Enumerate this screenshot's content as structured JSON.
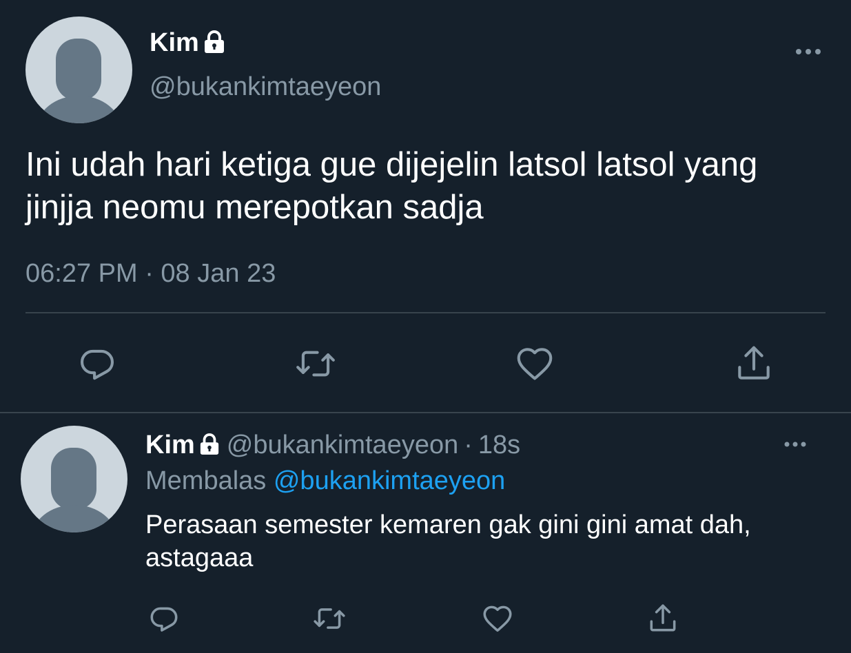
{
  "main_tweet": {
    "display_name": "Kim",
    "handle": "@bukankimtaeyeon",
    "text": "Ini udah hari ketiga gue dijejelin latsol latsol yang jinjja neomu merepotkan sadja",
    "timestamp": "06:27 PM · 08 Jan 23",
    "protected_icon": "lock-icon",
    "actions": [
      "reply-icon",
      "retweet-icon",
      "like-icon",
      "share-icon"
    ]
  },
  "reply_tweet": {
    "display_name": "Kim",
    "handle": "@bukankimtaeyeon",
    "separator": "·",
    "age": "18s",
    "replying_prefix": "Membalas",
    "replying_to": "@bukankimtaeyeon",
    "text": "Perasaan semester kemaren gak gini gini amat dah, astagaaa",
    "protected_icon": "lock-icon",
    "actions": [
      "reply-icon",
      "retweet-icon",
      "like-icon",
      "share-icon"
    ]
  },
  "colors": {
    "background": "#15202b",
    "primary_text": "#ffffff",
    "secondary_text": "#8899a6",
    "divider": "#38444d",
    "icon": "#8899a6",
    "link": "#1da1f2",
    "avatar_bg": "#ccd6dd",
    "avatar_silhouette": "#657786"
  }
}
